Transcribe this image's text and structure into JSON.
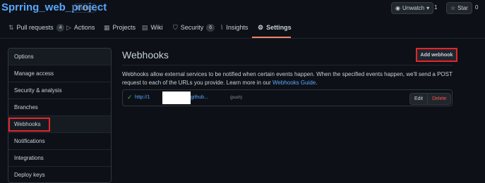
{
  "repo": {
    "name": "Sprring_web_project",
    "visibility": "Public"
  },
  "header_actions": {
    "watch_label": "Unwatch",
    "watch_count": "1",
    "star_label": "Star",
    "star_count": "0"
  },
  "tabs": [
    {
      "label": "Pull requests",
      "count": "4",
      "icon": "pull-request-icon"
    },
    {
      "label": "Actions",
      "icon": "play-icon"
    },
    {
      "label": "Projects",
      "icon": "project-icon"
    },
    {
      "label": "Wiki",
      "icon": "book-icon"
    },
    {
      "label": "Security",
      "count": "6",
      "icon": "shield-icon"
    },
    {
      "label": "Insights",
      "icon": "graph-icon"
    },
    {
      "label": "Settings",
      "icon": "gear-icon",
      "selected": true
    }
  ],
  "sidebar": {
    "items": [
      {
        "label": "Options"
      },
      {
        "label": "Manage access"
      },
      {
        "label": "Security & analysis"
      },
      {
        "label": "Branches"
      },
      {
        "label": "Webhooks",
        "selected": true
      },
      {
        "label": "Notifications"
      },
      {
        "label": "Integrations"
      },
      {
        "label": "Deploy keys"
      }
    ]
  },
  "main": {
    "title": "Webhooks",
    "add_button": "Add webhook",
    "description_part1": "Webhooks allow external services to be notified when certain events happen. When the specified events happen, we'll send a POST request to each of the URLs you provide. Learn more in our ",
    "guide_link": "Webhooks Guide",
    "description_end": ".",
    "webhook": {
      "url_prefix": "http://1",
      "url_suffix": "github...",
      "events": "(push)",
      "edit_label": "Edit",
      "delete_label": "Delete"
    }
  },
  "colors": {
    "background": "#0d1117",
    "link": "#58a6ff",
    "highlight": "#e5252a",
    "tab_underline": "#f78166",
    "success": "#3fb950",
    "danger": "#f85149"
  }
}
